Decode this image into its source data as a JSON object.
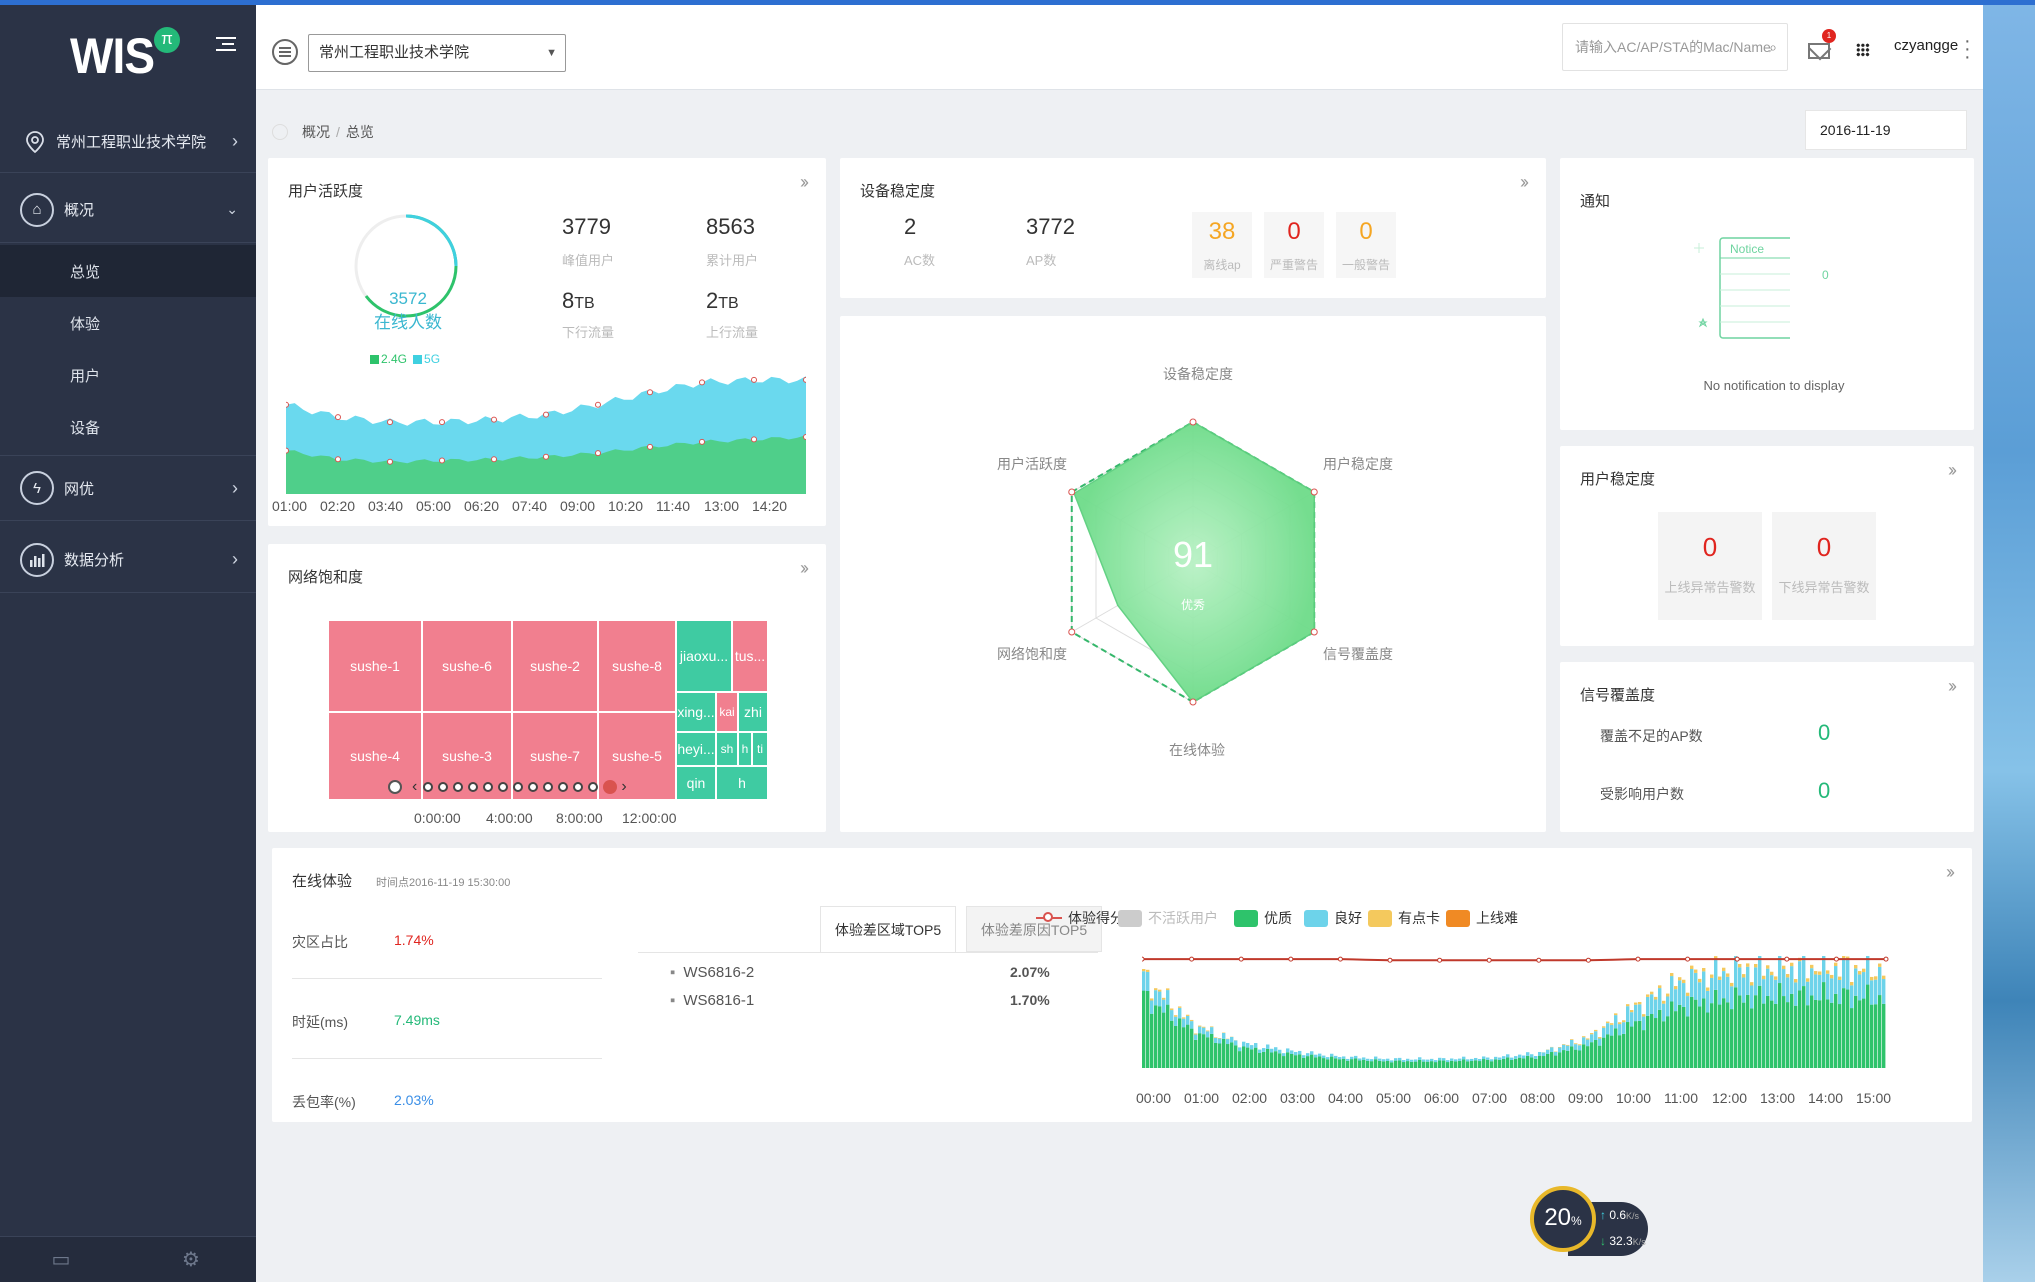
{
  "header": {
    "school": "常州工程职业技术学院",
    "search_placeholder": "请输入AC/AP/STA的Mac/Name",
    "username": "czyangge",
    "mail_badge": "1"
  },
  "sidebar": {
    "logo": "WIS",
    "logo_badge": "π",
    "school": "常州工程职业技术学院",
    "groups": [
      {
        "label": "概况",
        "icon": "home-icon"
      },
      {
        "label": "网优",
        "icon": "lightning-icon"
      },
      {
        "label": "数据分析",
        "icon": "bar-chart-icon"
      }
    ],
    "sub_items": [
      "总览",
      "体验",
      "用户",
      "设备"
    ]
  },
  "breadcrumb": {
    "root": "概况",
    "current": "总览"
  },
  "date": "2016-11-19",
  "user_activity": {
    "title": "用户活跃度",
    "online_count": "3572",
    "online_label": "在线人数",
    "legend_24": "2.4G",
    "legend_5": "5G",
    "stats": [
      {
        "value": "3779",
        "label": "峰值用户"
      },
      {
        "value": "8563",
        "label": "累计用户"
      },
      {
        "value": "8",
        "unit": "TB",
        "label": "下行流量"
      },
      {
        "value": "2",
        "unit": "TB",
        "label": "上行流量"
      }
    ]
  },
  "device_stability": {
    "title": "设备稳定度",
    "ac_count": "2",
    "ac_label": "AC数",
    "ap_count": "3772",
    "ap_label": "AP数",
    "status": [
      {
        "value": "38",
        "label": "离线ap",
        "color": "#f5a623"
      },
      {
        "value": "0",
        "label": "严重警告",
        "color": "#e0251f"
      },
      {
        "value": "0",
        "label": "一般警告",
        "color": "#f5a623"
      }
    ]
  },
  "radar": {
    "score": "91",
    "grade": "优秀",
    "axes": [
      "设备稳定度",
      "用户稳定度",
      "信号覆盖度",
      "在线体验",
      "网络饱和度",
      "用户活跃度"
    ]
  },
  "notice": {
    "title": "通知",
    "tag": "Notice",
    "empty": "No notification to display",
    "side_count": "0"
  },
  "user_stability": {
    "title": "用户稳定度",
    "items": [
      {
        "value": "0",
        "label": "上线异常告警数"
      },
      {
        "value": "0",
        "label": "下线异常告警数"
      }
    ]
  },
  "signal_coverage": {
    "title": "信号覆盖度",
    "rows": [
      {
        "label": "覆盖不足的AP数",
        "value": "0"
      },
      {
        "label": "受影响用户数",
        "value": "0"
      }
    ]
  },
  "network_saturation": {
    "title": "网络饱和度",
    "cells": [
      {
        "label": "sushe-1",
        "color": "pink"
      },
      {
        "label": "sushe-6",
        "color": "pink"
      },
      {
        "label": "sushe-2",
        "color": "pink"
      },
      {
        "label": "sushe-8",
        "color": "pink"
      },
      {
        "label": "sushe-4",
        "color": "pink"
      },
      {
        "label": "sushe-3",
        "color": "pink"
      },
      {
        "label": "sushe-7",
        "color": "pink"
      },
      {
        "label": "sushe-5",
        "color": "pink"
      },
      {
        "label": "jiaoxu...",
        "color": "green"
      },
      {
        "label": "tus...",
        "color": "pink"
      },
      {
        "label": "xing...",
        "color": "green"
      },
      {
        "label": "kai",
        "color": "pink"
      },
      {
        "label": "zhi",
        "color": "green"
      },
      {
        "label": "heyi...",
        "color": "green"
      },
      {
        "label": "sh",
        "color": "green"
      },
      {
        "label": "h",
        "color": "green"
      },
      {
        "label": "ti",
        "color": "green"
      },
      {
        "label": "qin",
        "color": "green"
      },
      {
        "label": "h",
        "color": "green"
      }
    ],
    "timeline": [
      "0:00:00",
      "4:00:00",
      "8:00:00",
      "12:00:00"
    ]
  },
  "online_experience": {
    "title": "在线体验",
    "timestamp": "时间点2016-11-19 15:30:00",
    "metrics": [
      {
        "label": "灾区占比",
        "value": "1.74%",
        "color": "#e0251f"
      },
      {
        "label": "时延(ms)",
        "value": "7.49ms",
        "color": "#24b979"
      },
      {
        "label": "丢包率(%)",
        "value": "2.03%",
        "color": "#3a8ee6"
      }
    ],
    "tabs": [
      "体验差区域TOP5",
      "体验差原因TOP5"
    ],
    "top5": [
      {
        "name": "WS6816-2",
        "value": "2.07%"
      },
      {
        "name": "WS6816-1",
        "value": "1.70%"
      }
    ],
    "legend": [
      {
        "label": "体验得分",
        "color": "#d9534f"
      },
      {
        "label": "不活跃用户",
        "color": "#cccccc"
      },
      {
        "label": "优质",
        "color": "#2ec36b"
      },
      {
        "label": "良好",
        "color": "#6dd3ea"
      },
      {
        "label": "有点卡",
        "color": "#f4c95d"
      },
      {
        "label": "上线难",
        "color": "#f08a24"
      }
    ]
  },
  "speed_widget": {
    "percent": "20",
    "percent_unit": "%",
    "up": "0.6",
    "down": "32.3",
    "unit": "K/s"
  },
  "chart_data": [
    {
      "type": "area",
      "title": "用户活跃度",
      "x": [
        "01:00",
        "02:20",
        "03:40",
        "05:00",
        "06:20",
        "07:40",
        "09:00",
        "10:20",
        "11:40",
        "13:00",
        "14:20"
      ],
      "series": [
        {
          "name": "2.4G",
          "values": [
            35,
            28,
            26,
            27,
            28,
            30,
            33,
            38,
            42,
            44,
            46
          ]
        },
        {
          "name": "5G",
          "values": [
            72,
            62,
            58,
            58,
            60,
            64,
            72,
            82,
            90,
            92,
            92
          ]
        }
      ]
    },
    {
      "type": "bar",
      "x": [
        "00:00",
        "01:00",
        "02:00",
        "03:00",
        "04:00",
        "05:00",
        "06:00",
        "07:00",
        "08:00",
        "09:00",
        "10:00",
        "11:00",
        "12:00",
        "13:00",
        "14:00",
        "15:00"
      ],
      "series": [
        {
          "name": "优质",
          "values": [
            64,
            32,
            18,
            12,
            8,
            6,
            6,
            7,
            10,
            20,
            40,
            56,
            62,
            64,
            64,
            62
          ]
        },
        {
          "name": "良好",
          "values": [
            16,
            6,
            4,
            3,
            2,
            2,
            2,
            2,
            3,
            6,
            14,
            22,
            24,
            24,
            24,
            24
          ]
        },
        {
          "name": "有点卡",
          "values": [
            2,
            1,
            0,
            0,
            0,
            0,
            0,
            0,
            0,
            1,
            2,
            3,
            3,
            3,
            3,
            3
          ]
        },
        {
          "name": "体验得分",
          "values": [
            99,
            99,
            99,
            99,
            99,
            98,
            98,
            98,
            98,
            98,
            99,
            99,
            99,
            99,
            99,
            99
          ]
        }
      ]
    }
  ]
}
